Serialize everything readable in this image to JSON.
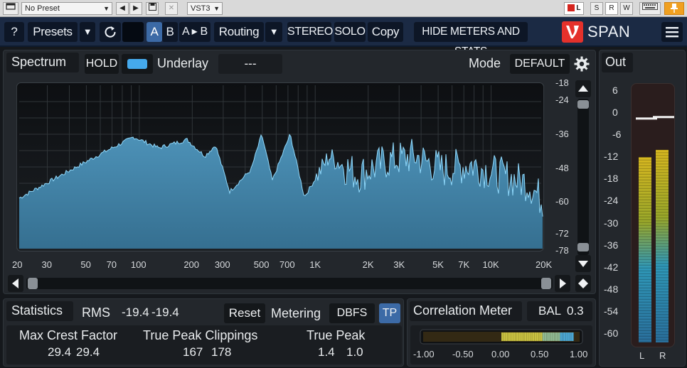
{
  "host": {
    "preset": "No Preset",
    "format": "VST3",
    "right_buttons": [
      "S",
      "R",
      "W"
    ],
    "left_badge": "L"
  },
  "toolbar": {
    "help": "?",
    "presets": "Presets",
    "ab_a": "A",
    "ab_b": "B",
    "ab_copy": "A ▸ B",
    "routing": "Routing",
    "stereo": "STEREO",
    "solo": "SOLO",
    "copy": "Copy",
    "hide_meters": "HIDE METERS AND STATS",
    "logo": "SPAN",
    "brand_color": "#e4312b"
  },
  "spectrum": {
    "title": "Spectrum",
    "hold": "HOLD",
    "underlay_label": "Underlay",
    "underlay_value": "---",
    "mode_label": "Mode",
    "mode_value": "DEFAULT",
    "db_ticks": [
      "-18",
      "-24",
      "-36",
      "-48",
      "-60",
      "-72",
      "-78"
    ],
    "freq_ticks": [
      "20",
      "30",
      "50",
      "70",
      "100",
      "200",
      "300",
      "500",
      "700",
      "1K",
      "2K",
      "3K",
      "5K",
      "7K",
      "10K",
      "20K"
    ],
    "fill_color": "#3d7ea1",
    "line_color": "#7fd0f5"
  },
  "out": {
    "title": "Out",
    "scale": [
      "6",
      "0",
      "-6",
      "-12",
      "-18",
      "-24",
      "-30",
      "-36",
      "-42",
      "-48",
      "-54",
      "-60"
    ],
    "channels": [
      "L",
      "R"
    ],
    "levels_db": [
      -12,
      -10
    ],
    "peaks_db": [
      -1.4,
      -1.0
    ]
  },
  "stats": {
    "title": "Statistics",
    "rms_label": "RMS",
    "rms_l": "-19.4",
    "rms_r": "-19.4",
    "reset": "Reset",
    "metering_label": "Metering",
    "metering_value": "DBFS",
    "tp": "TP",
    "crest_label": "Max Crest Factor",
    "crest_l": "29.4",
    "crest_r": "29.4",
    "clip_label": "True Peak Clippings",
    "clip_l": "167",
    "clip_r": "178",
    "tp_label": "True Peak",
    "tp_l": "1.4",
    "tp_r": "1.0"
  },
  "correlation": {
    "title": "Correlation Meter",
    "bal_label": "BAL",
    "bal_value": "0.3",
    "ticks": [
      "-1.00",
      "-0.50",
      "0.00",
      "0.50",
      "1.00"
    ]
  }
}
